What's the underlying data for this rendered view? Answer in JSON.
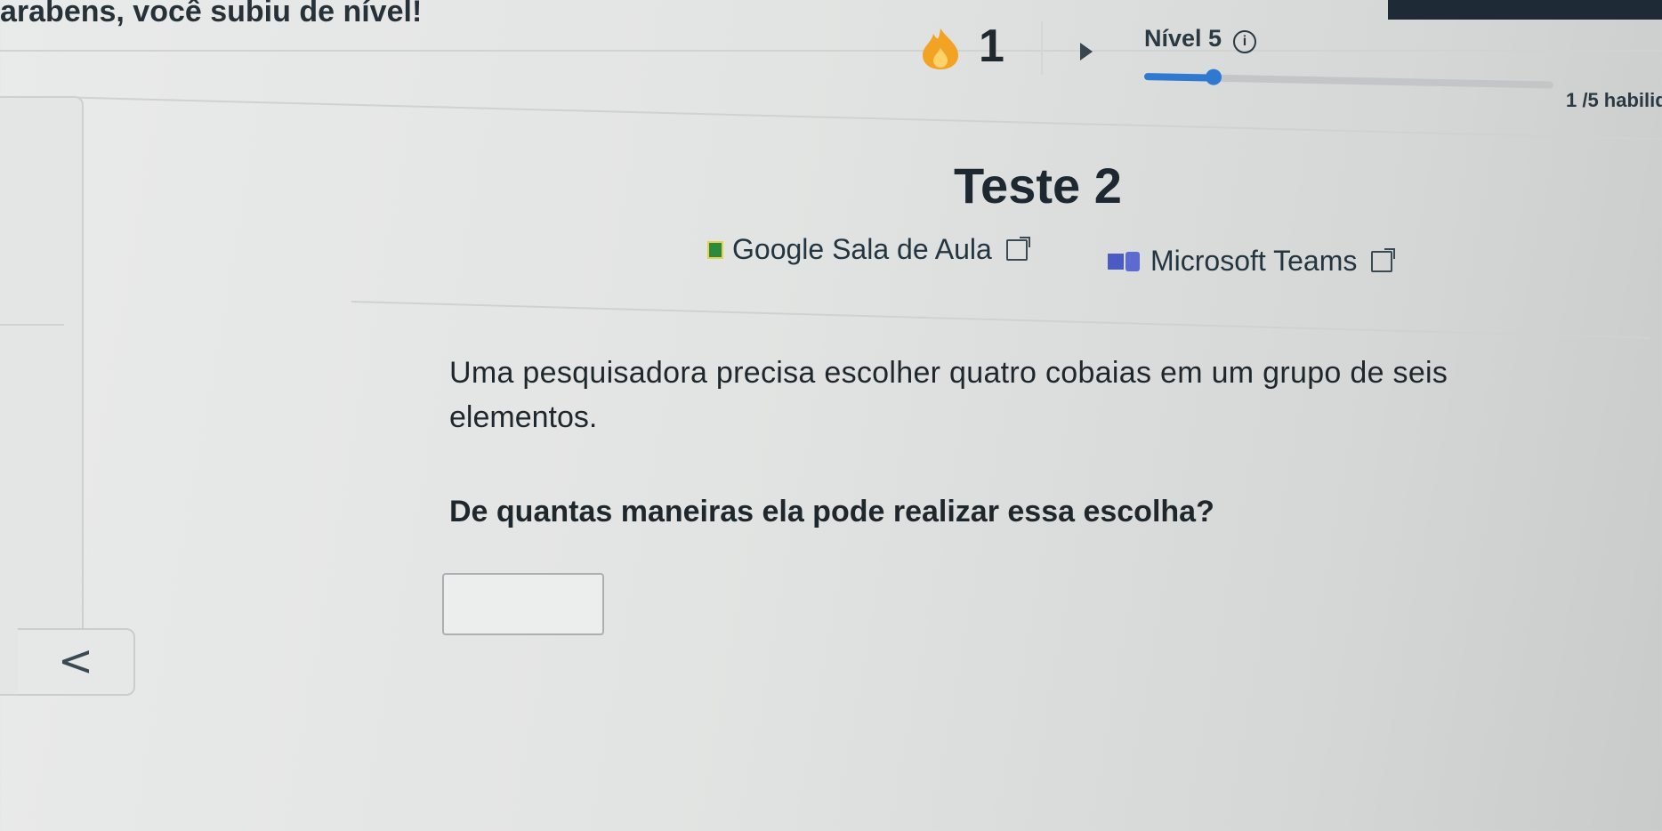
{
  "banner": {
    "text": "arabens, você subiu de nível!"
  },
  "streak": {
    "count": "1"
  },
  "level": {
    "label": "Nível 5",
    "info": "i",
    "progress": 0.17,
    "skills_text": "1 /5 habilid"
  },
  "page": {
    "title": "Teste 2"
  },
  "links": {
    "classroom": "Google Sala de Aula",
    "teams": "Microsoft Teams"
  },
  "question": {
    "line1": "Uma pesquisadora precisa escolher quatro cobaias em um grupo de seis",
    "line2": "elementos.",
    "prompt": "De quantas maneiras ela pode realizar essa escolha?"
  },
  "answer": {
    "value": ""
  },
  "nav": {
    "back": "<"
  },
  "colors": {
    "accent": "#2f79d0",
    "streak": "#f2a324"
  }
}
